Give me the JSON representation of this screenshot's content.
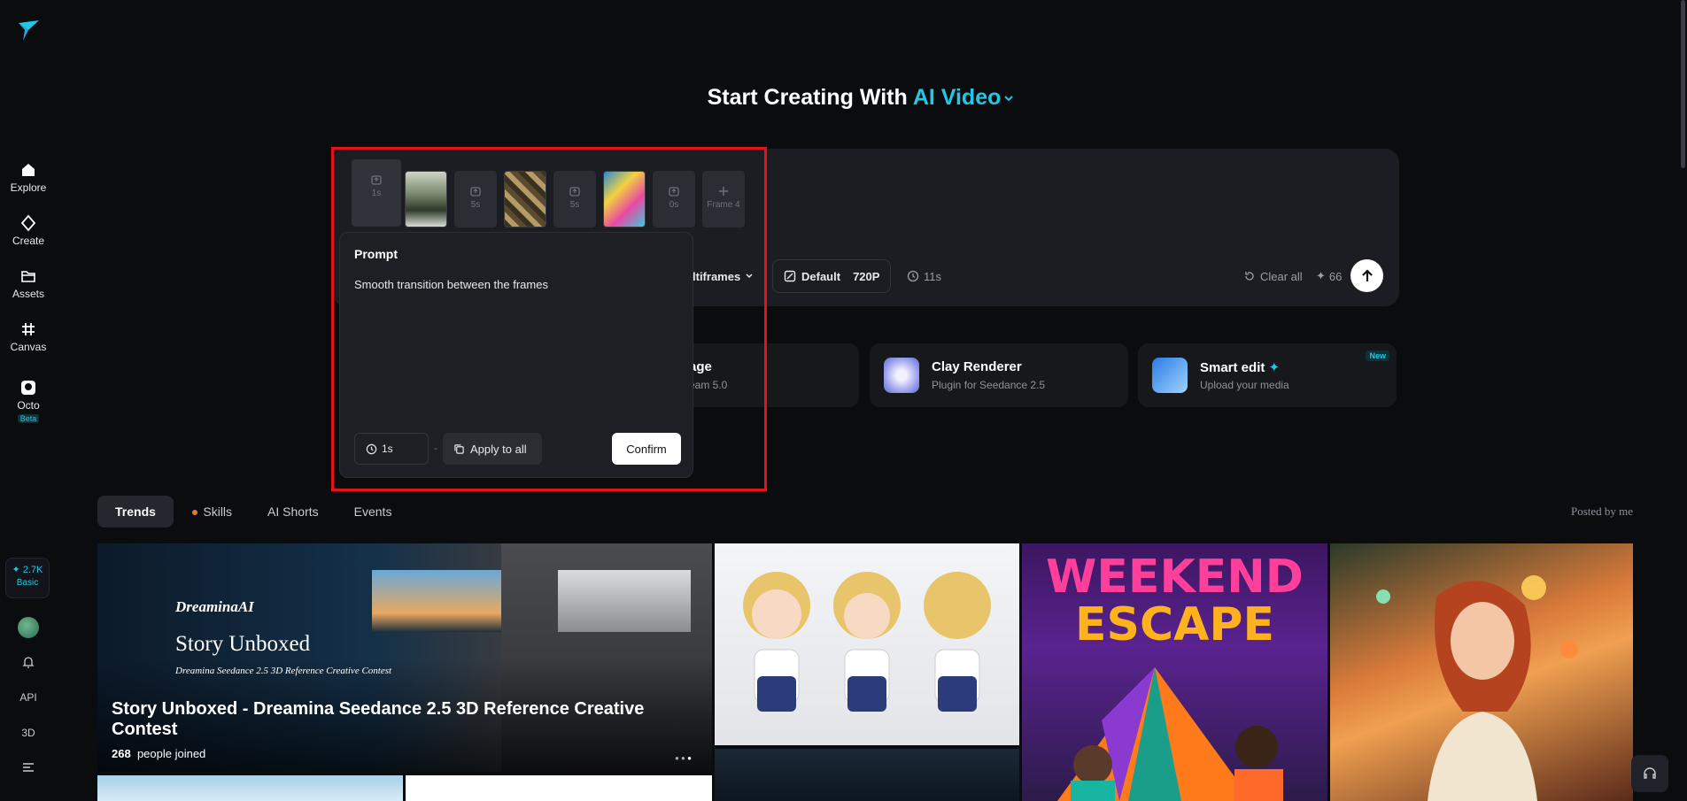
{
  "sidebar": {
    "items": [
      {
        "label": "Explore",
        "icon": "home-icon"
      },
      {
        "label": "Create",
        "icon": "diamond-icon"
      },
      {
        "label": "Assets",
        "icon": "folder-icon"
      },
      {
        "label": "Canvas",
        "icon": "canvas-icon"
      },
      {
        "label": "Octo",
        "icon": "octo-icon",
        "badge": "Beta"
      }
    ],
    "credits": {
      "value": "✦ 2.7K",
      "tier": "Basic"
    },
    "api_label": "API",
    "three_d_label": "3D"
  },
  "header": {
    "title_prefix": "Start Creating With",
    "title_accent": "AI Video"
  },
  "frames": {
    "slots": [
      "1s",
      "5s",
      "5s",
      "0s"
    ],
    "add_label": "Frame 4"
  },
  "prompt_bar": {
    "mode_label": "ltiframes",
    "model_label": "Default",
    "resolution": "720P",
    "duration": "11s",
    "clear_label": "Clear all",
    "credits_cost": "66"
  },
  "popup": {
    "title": "Prompt",
    "text": "Smooth transition between the frames",
    "duration": "1s",
    "apply_all_label": "Apply to all",
    "confirm_label": "Confirm"
  },
  "features": [
    {
      "title": "age",
      "subtitle": "eam 5.0"
    },
    {
      "title": "Clay Renderer",
      "subtitle": "Plugin for Seedance 2.5"
    },
    {
      "title": "Smart edit",
      "subtitle": "Upload your media",
      "badge": "New"
    }
  ],
  "tabs": [
    {
      "label": "Trends",
      "active": true
    },
    {
      "label": "Skills",
      "active": false
    },
    {
      "label": "AI Shorts",
      "active": false
    },
    {
      "label": "Events",
      "active": false
    }
  ],
  "posted_label": "Posted by me",
  "hero": {
    "brand": "DreaminaAI",
    "headline": "Story Unboxed",
    "sub": "Dreamina Seedance 2.5 3D Reference Creative Contest",
    "title": "Story Unboxed - Dreamina Seedance 2.5 3D Reference Creative Contest",
    "joined_count": "268",
    "joined_suffix": "people joined"
  },
  "weekend": {
    "line1": "WEEKEND",
    "line2": "ESCAPE"
  },
  "colors": {
    "accent": "#20c8e6",
    "highlight": "#e5121e",
    "background": "#0b0c0e"
  }
}
